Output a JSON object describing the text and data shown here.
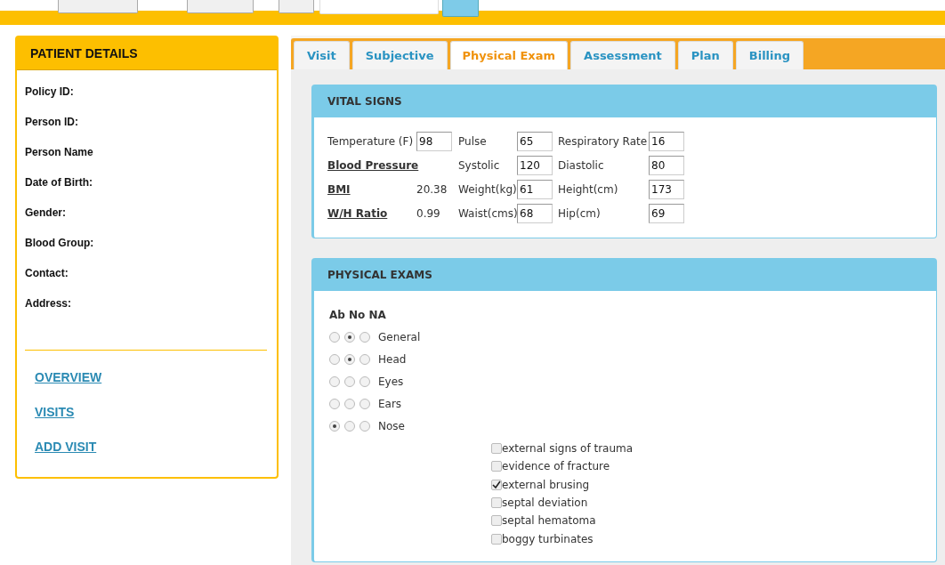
{
  "patient_panel": {
    "title": "PATIENT DETAILS",
    "fields": [
      "Policy ID:",
      "Person ID:",
      "Person Name",
      "Date of Birth:",
      "Gender:",
      "Blood Group:",
      "Contact:",
      "Address:"
    ],
    "links": [
      "OVERVIEW",
      "VISITS",
      "ADD VISIT"
    ]
  },
  "tabs": [
    {
      "label": "Visit",
      "selected": false
    },
    {
      "label": "Subjective",
      "selected": false
    },
    {
      "label": "Physical Exam",
      "selected": true
    },
    {
      "label": "Assessment",
      "selected": false
    },
    {
      "label": "Plan",
      "selected": false
    },
    {
      "label": "Billing",
      "selected": false
    }
  ],
  "vital_signs": {
    "title": "VITAL SIGNS",
    "rows": [
      {
        "label": "Temperature (F)",
        "link": false,
        "value": "98",
        "kind": "input",
        "label_2": "Pulse",
        "value_2": "65",
        "label_3": "Respiratory Rate",
        "value_3": "16"
      },
      {
        "label": "Blood Pressure",
        "link": true,
        "kind": "none",
        "label_2": "Systolic",
        "value_2": "120",
        "label_3": "Diastolic",
        "value_3": "80"
      },
      {
        "label": "BMI",
        "link": true,
        "value": "20.38",
        "kind": "text",
        "label_2": "Weight(kg)",
        "value_2": "61",
        "label_3": "Height(cm)",
        "value_3": "173"
      },
      {
        "label": "W/H Ratio",
        "link": true,
        "value": "0.99",
        "kind": "text",
        "label_2": "Waist(cms)",
        "value_2": "68",
        "label_3": "Hip(cm)",
        "value_3": "69"
      }
    ]
  },
  "physical_exams": {
    "title": "PHYSICAL EXAMS",
    "header": "Ab No NA",
    "exams": [
      {
        "label": "General",
        "ab": false,
        "no": true,
        "na": false
      },
      {
        "label": "Head",
        "ab": false,
        "no": true,
        "na": false
      },
      {
        "label": "Eyes",
        "ab": false,
        "no": false,
        "na": false
      },
      {
        "label": "Ears",
        "ab": false,
        "no": false,
        "na": false
      },
      {
        "label": "Nose",
        "ab": true,
        "no": false,
        "na": false
      }
    ],
    "findings": [
      {
        "label": "external signs of trauma",
        "checked": false
      },
      {
        "label": "evidence of fracture",
        "checked": false
      },
      {
        "label": "external brusing",
        "checked": true
      },
      {
        "label": "septal deviation",
        "checked": false
      },
      {
        "label": "septal hematoma",
        "checked": false
      },
      {
        "label": "boggy turbinates",
        "checked": false
      }
    ]
  }
}
